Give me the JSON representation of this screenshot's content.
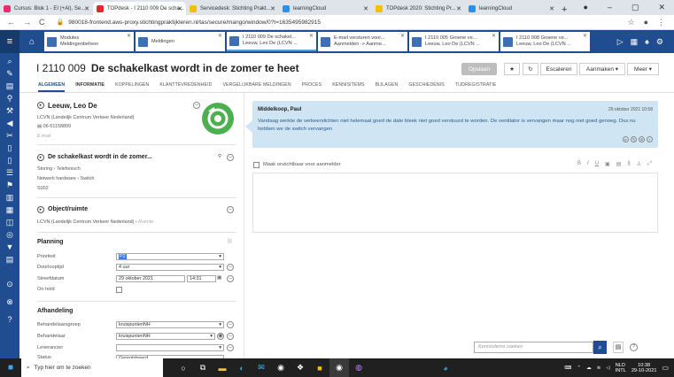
{
  "browser": {
    "tabs": [
      {
        "label": "Cursus: Blok 1 - EI (+Al), Se...",
        "color": "#e1306c"
      },
      {
        "label": "TOPdesk - I 2110 009 De scha...",
        "color": "#d92b2b",
        "active": true
      },
      {
        "label": "Servicedesk: Stichting Prakt...",
        "color": "#f2c200"
      },
      {
        "label": "learningCloud",
        "color": "#2f8fe0"
      },
      {
        "label": "TOPdesk 2020: Stichting Pr...",
        "color": "#f2c200"
      },
      {
        "label": "learningCloud",
        "color": "#2f8fe0"
      }
    ],
    "new_tab": "+",
    "url": "980018-frontend.aws-proxy.stichtingpraktijkleren.nl/tas/secure/mango/window/0?t=1635495982915"
  },
  "app_tabs": [
    {
      "line1": "Modules",
      "line2": "Meldingenbeheer",
      "icon_color": "#3d6fb6"
    },
    {
      "line1": "Meldingen",
      "line2": "",
      "icon_color": "#3d6fb6"
    },
    {
      "line1": "I 2110 009 De schakel...",
      "line2": "Leeuw, Leo De (LCVN ...",
      "icon_color": "#3d6fb6",
      "current": true
    },
    {
      "line1": "E-mail versturen voor...",
      "line2": "Aanmelden -> Aanme...",
      "icon_color": "#3d6fb6"
    },
    {
      "line1": "I 2110 005 Groene ve...",
      "line2": "Leeuw, Leo De (LCVN ...",
      "icon_color": "#3d6fb6"
    },
    {
      "line1": "I 2110 008 Groene ve...",
      "line2": "Leeuw, Leo De (LCVN ...",
      "icon_color": "#3d6fb6"
    }
  ],
  "header": {
    "number": "I 2110 009",
    "title": "De schakelkast wordt in de zomer te heet",
    "buttons": {
      "save": "Opslaan",
      "escalate": "Escaleren",
      "create": "Aanmaken",
      "more": "Meer"
    },
    "tabs": [
      "ALGEMEEN",
      "INFORMATIE",
      "KOPPELINGEN",
      "KLANTTEVREDENHEID",
      "VERGELIJKBARE MELDINGEN",
      "PROCES",
      "KENNISITEMS",
      "BIJLAGEN",
      "GESCHIEDENIS",
      "TIJDREGISTRATIE"
    ]
  },
  "caller": {
    "name": "Leeuw, Leo De",
    "org": "LCVN (Landelijk Centrum Verkeer Nederland)",
    "phone": "06-51158899",
    "email_placeholder": "E-mail"
  },
  "request": {
    "title": "De schakelkast wordt in de zomer...",
    "category": "Storing",
    "category_sub": "Telefonisch",
    "object": "Netwerk hardware",
    "object_sub": "Switch",
    "code": "S002"
  },
  "object_section": {
    "title": "Object/ruimte",
    "value": "LCVN (Landelijk Centrum Verkeer Nederland)",
    "room_placeholder": "Ruimte"
  },
  "planning": {
    "title": "Planning",
    "labels": {
      "priority": "Prioriteit",
      "duration": "Doorlooptijd",
      "deadline": "Streefdatum",
      "onhold": "On hold"
    },
    "priority_value": "P2",
    "duration_value": "4 uur",
    "date_value": "29 oktober 2021",
    "time_value": "14:31"
  },
  "handling": {
    "title": "Afhandeling",
    "labels": {
      "group": "Behandelaarsgroep",
      "operator": "Behandelaar",
      "supplier": "Leverancier",
      "status": "Status"
    },
    "group_value": "kruispuntenNH",
    "operator_value": "kruispuntenNH",
    "status_value": "Geregistreerd"
  },
  "message": {
    "author": "Middelkoop, Paul",
    "date": "29 oktober 2021 10:58",
    "text": "Vandaag werkte de verkeerslichten niet helemaal goed de date bleek niet goed verstuurd te worden. De ventilator is vervangen maar nog niet goed genoeg. Dus nu hebben we de switch vervangen"
  },
  "editor": {
    "checkbox_label": "Maak onzichtbaar voor aanmelder"
  },
  "kennis": {
    "placeholder": "Kennisitems zoeken"
  },
  "taskbar": {
    "search_placeholder": "Typ hier om te zoeken",
    "lang1": "NLD",
    "lang2": "INTL",
    "time": "10:38",
    "date": "29-10-2021"
  }
}
